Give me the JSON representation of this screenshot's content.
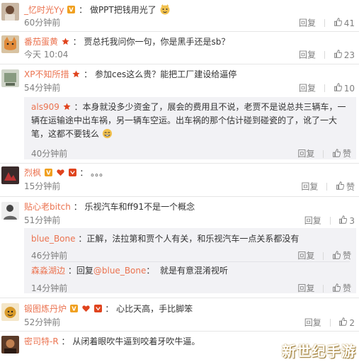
{
  "labels": {
    "reply": "回复",
    "like": "赞"
  },
  "comments": [
    {
      "user": "_忆时光Yy",
      "text": "做PPT把钱用光了",
      "time": "60分钟前",
      "likes": "41"
    },
    {
      "user": "番茄蛋黄",
      "text": "贾总托我问你一句，你是黑手还是sb？",
      "time": "今天 10:04",
      "likes": "23"
    },
    {
      "user": "XP不知所措",
      "text": "参加ces这么贵？能把工厂建设给逼停",
      "time": "54分钟前",
      "likes": "10",
      "replies": [
        {
          "user": "als909",
          "text": "本身就没多少资金了，展会的费用且不说，老贾不是说总共三辆车，一辆在运输途中出车祸，另一辆车空运。出车祸的那个估计碰到碰瓷的了，讹了一大笔，这都不要钱么",
          "time": "40分钟前"
        }
      ]
    },
    {
      "user": "烈枫",
      "text": "。。。",
      "time": "15分钟前"
    },
    {
      "user": "贴心老bitch",
      "text": "乐视汽车和ff91不是一个概念",
      "time": "51分钟前",
      "likes": "3",
      "replies": [
        {
          "user": "blue_Bone",
          "text": "正解，法拉第和贾个人有关，和乐视汽车一点关系都没有",
          "time": "46分钟前"
        },
        {
          "user": "森淼湖边",
          "reply_prefix": "回复",
          "reply_to": "@blue_Bone",
          "text": "就是有意混淆视听",
          "time": "14分钟前"
        }
      ]
    },
    {
      "user": "锻图炼丹炉",
      "text": "心比天高，手比脚笨",
      "time": "52分钟前",
      "likes": "2"
    },
    {
      "user": "密司特-R",
      "text": "从闭着眼吹牛逼到咬着牙吹牛逼。",
      "time": ""
    }
  ],
  "watermark": "新世纪手游",
  "colors": {
    "username": "#eb7350",
    "meta": "#808080",
    "reply_bg": "#f2f2f5",
    "badge_red": "#e0441e",
    "badge_gold": "#f0a020"
  }
}
